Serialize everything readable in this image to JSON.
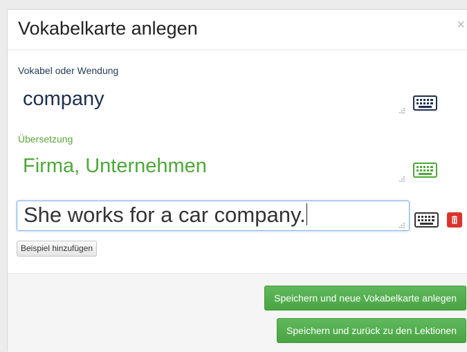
{
  "dialog": {
    "title": "Vokabelkarte anlegen",
    "close_glyph": "×"
  },
  "vocab": {
    "label": "Vokabel oder Wendung",
    "value": "company",
    "color": "#1e2f4d",
    "keyboard_icon": "keyboard-icon"
  },
  "translation": {
    "label": "Übersetzung",
    "value": "Firma, Unternehmen",
    "color": "#4ea83a",
    "keyboard_icon": "keyboard-icon"
  },
  "example": {
    "value": "She works for a car company.",
    "keyboard_icon": "keyboard-icon",
    "delete_icon": "trash-icon",
    "delete_color": "#d9342b"
  },
  "add_example_label": "Beispiel hinzufügen",
  "footer": {
    "save_new_label": "Speichern und neue Vokabelkarte anlegen",
    "save_back_label": "Speichern und zurück zu den Lektionen",
    "button_color": "#4aa444"
  }
}
